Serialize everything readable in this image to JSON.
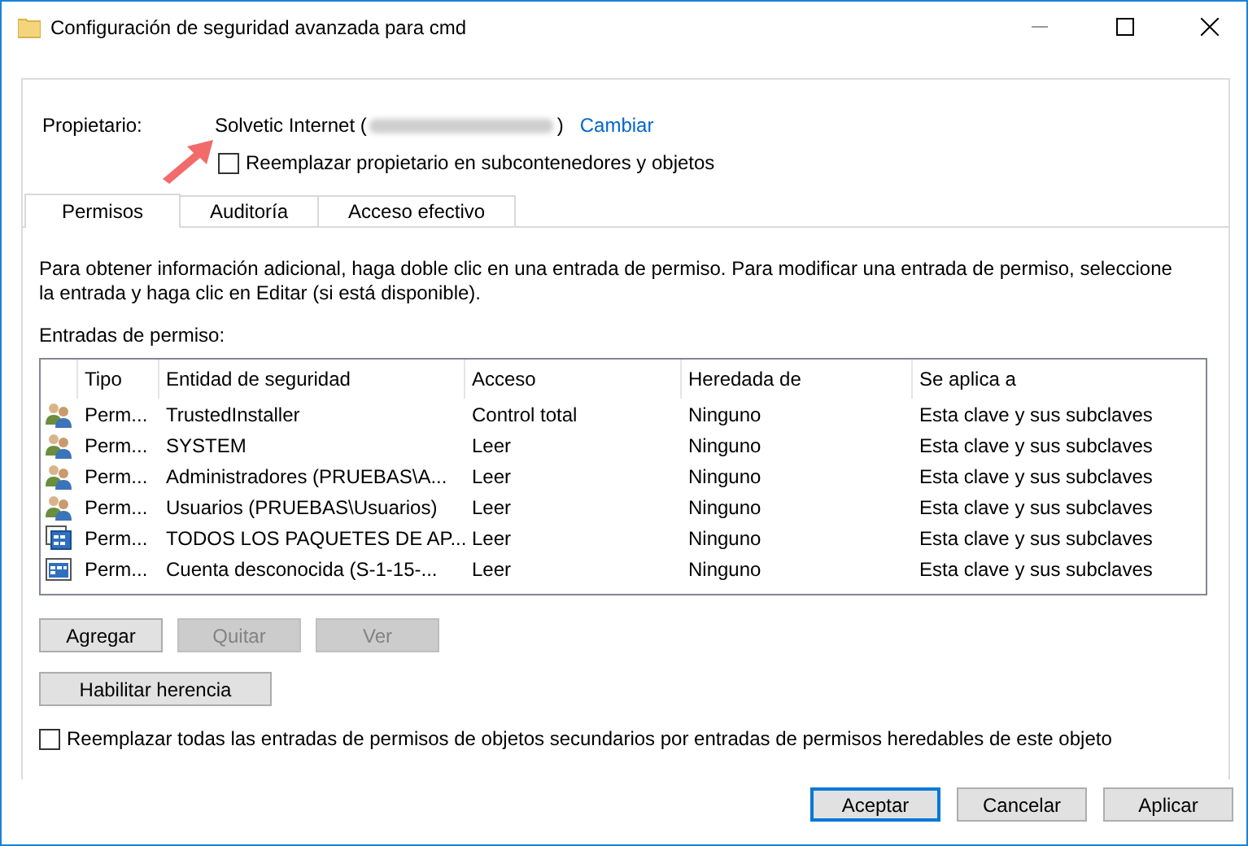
{
  "window": {
    "title": "Configuración de seguridad avanzada para cmd"
  },
  "owner": {
    "label": "Propietario:",
    "name": "Solvetic Internet (",
    "close": ")",
    "change_link": "Cambiar",
    "replace_checkbox": {
      "label": "Reemplazar propietario en subcontenedores y objetos",
      "checked": false
    }
  },
  "tabs": [
    {
      "label": "Permisos",
      "selected": true
    },
    {
      "label": "Auditoría",
      "selected": false
    },
    {
      "label": "Acceso efectivo",
      "selected": false
    }
  ],
  "description": "Para obtener información adicional, haga doble clic en una entrada de permiso. Para modificar una entrada de permiso, seleccione la entrada y haga clic en Editar (si está disponible).",
  "entries_label": "Entradas de permiso:",
  "table": {
    "columns": [
      "Tipo",
      "Entidad de seguridad",
      "Acceso",
      "Heredada de",
      "Se aplica a"
    ],
    "rows": [
      {
        "kind": "group",
        "cells": [
          "Perm...",
          "TrustedInstaller",
          "Control total",
          "Ninguno",
          "Esta clave y sus subclaves"
        ]
      },
      {
        "kind": "group",
        "cells": [
          "Perm...",
          "SYSTEM",
          "Leer",
          "Ninguno",
          "Esta clave y sus subclaves"
        ]
      },
      {
        "kind": "group",
        "cells": [
          "Perm...",
          "Administradores (PRUEBAS\\A...",
          "Leer",
          "Ninguno",
          "Esta clave y sus subclaves"
        ]
      },
      {
        "kind": "group",
        "cells": [
          "Perm...",
          "Usuarios (PRUEBAS\\Usuarios)",
          "Leer",
          "Ninguno",
          "Esta clave y sus subclaves"
        ]
      },
      {
        "kind": "app",
        "cells": [
          "Perm...",
          "TODOS LOS PAQUETES DE AP...",
          "Leer",
          "Ninguno",
          "Esta clave y sus subclaves"
        ]
      },
      {
        "kind": "app2",
        "cells": [
          "Perm...",
          "Cuenta desconocida (S-1-15-...",
          "Leer",
          "Ninguno",
          "Esta clave y sus subclaves"
        ]
      }
    ]
  },
  "entry_buttons": [
    {
      "label": "Agregar",
      "disabled": false
    },
    {
      "label": "Quitar",
      "disabled": true
    },
    {
      "label": "Ver",
      "disabled": true
    }
  ],
  "inheritance_button": {
    "label": "Habilitar herencia"
  },
  "replace_all_checkbox": {
    "label": "Reemplazar todas las entradas de permisos de objetos secundarios por entradas de permisos heredables de este objeto",
    "checked": false
  },
  "dialog_buttons": [
    {
      "label": "Aceptar",
      "default": true
    },
    {
      "label": "Cancelar",
      "default": false
    },
    {
      "label": "Aplicar",
      "default": false
    }
  ]
}
